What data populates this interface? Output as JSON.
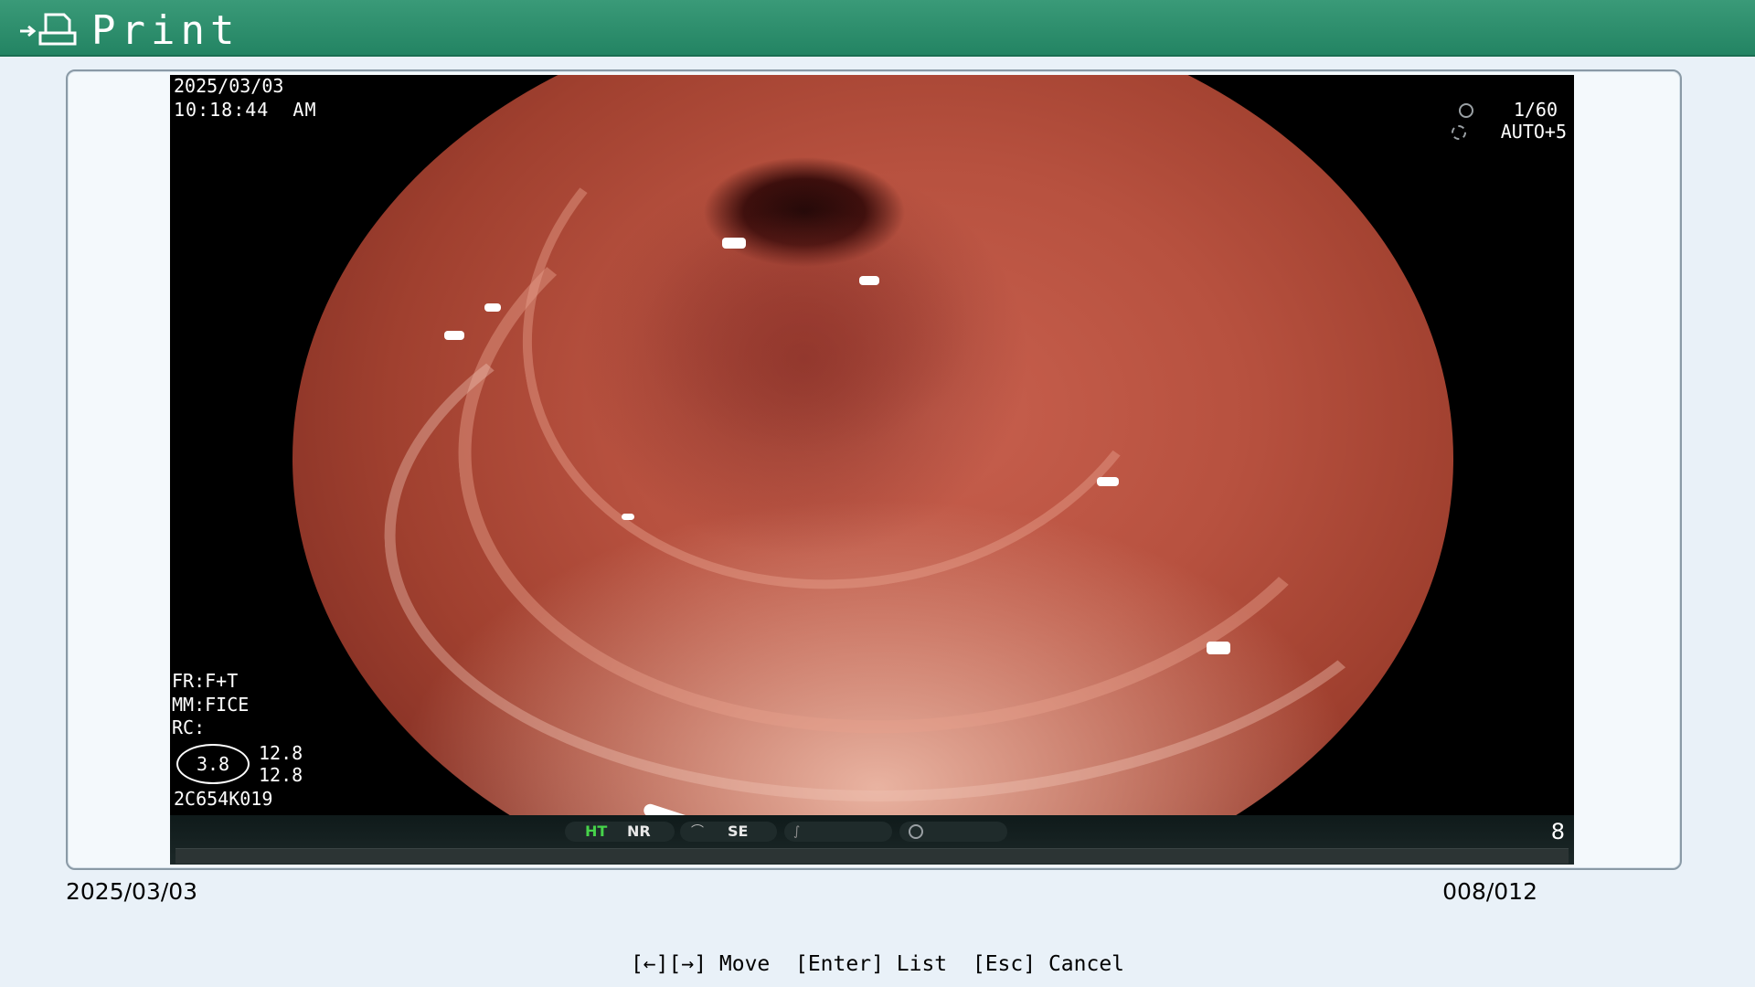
{
  "header": {
    "title": "Print",
    "icon": "print-icon",
    "color": "#2a8a6a"
  },
  "overlay": {
    "date": "2025/03/03",
    "time": "10:18:44  AM",
    "shutter": "1/60",
    "auto": "AUTO+5",
    "fr": "FR:F+T",
    "mm": "MM:FICE",
    "rc": "RC:",
    "circle_value": "3.8",
    "value_1": "12.8",
    "value_2": "12.8",
    "device_id": "2C654K019"
  },
  "status_bar": {
    "ht": "HT",
    "nr": "NR",
    "se": "SE",
    "number": "8",
    "ht_color": "#46d34a"
  },
  "info": {
    "date": "2025/03/03",
    "counter": "008/012"
  },
  "footer": {
    "move": "[←][→] Move",
    "list": "[Enter] List",
    "cancel": "[Esc] Cancel"
  }
}
